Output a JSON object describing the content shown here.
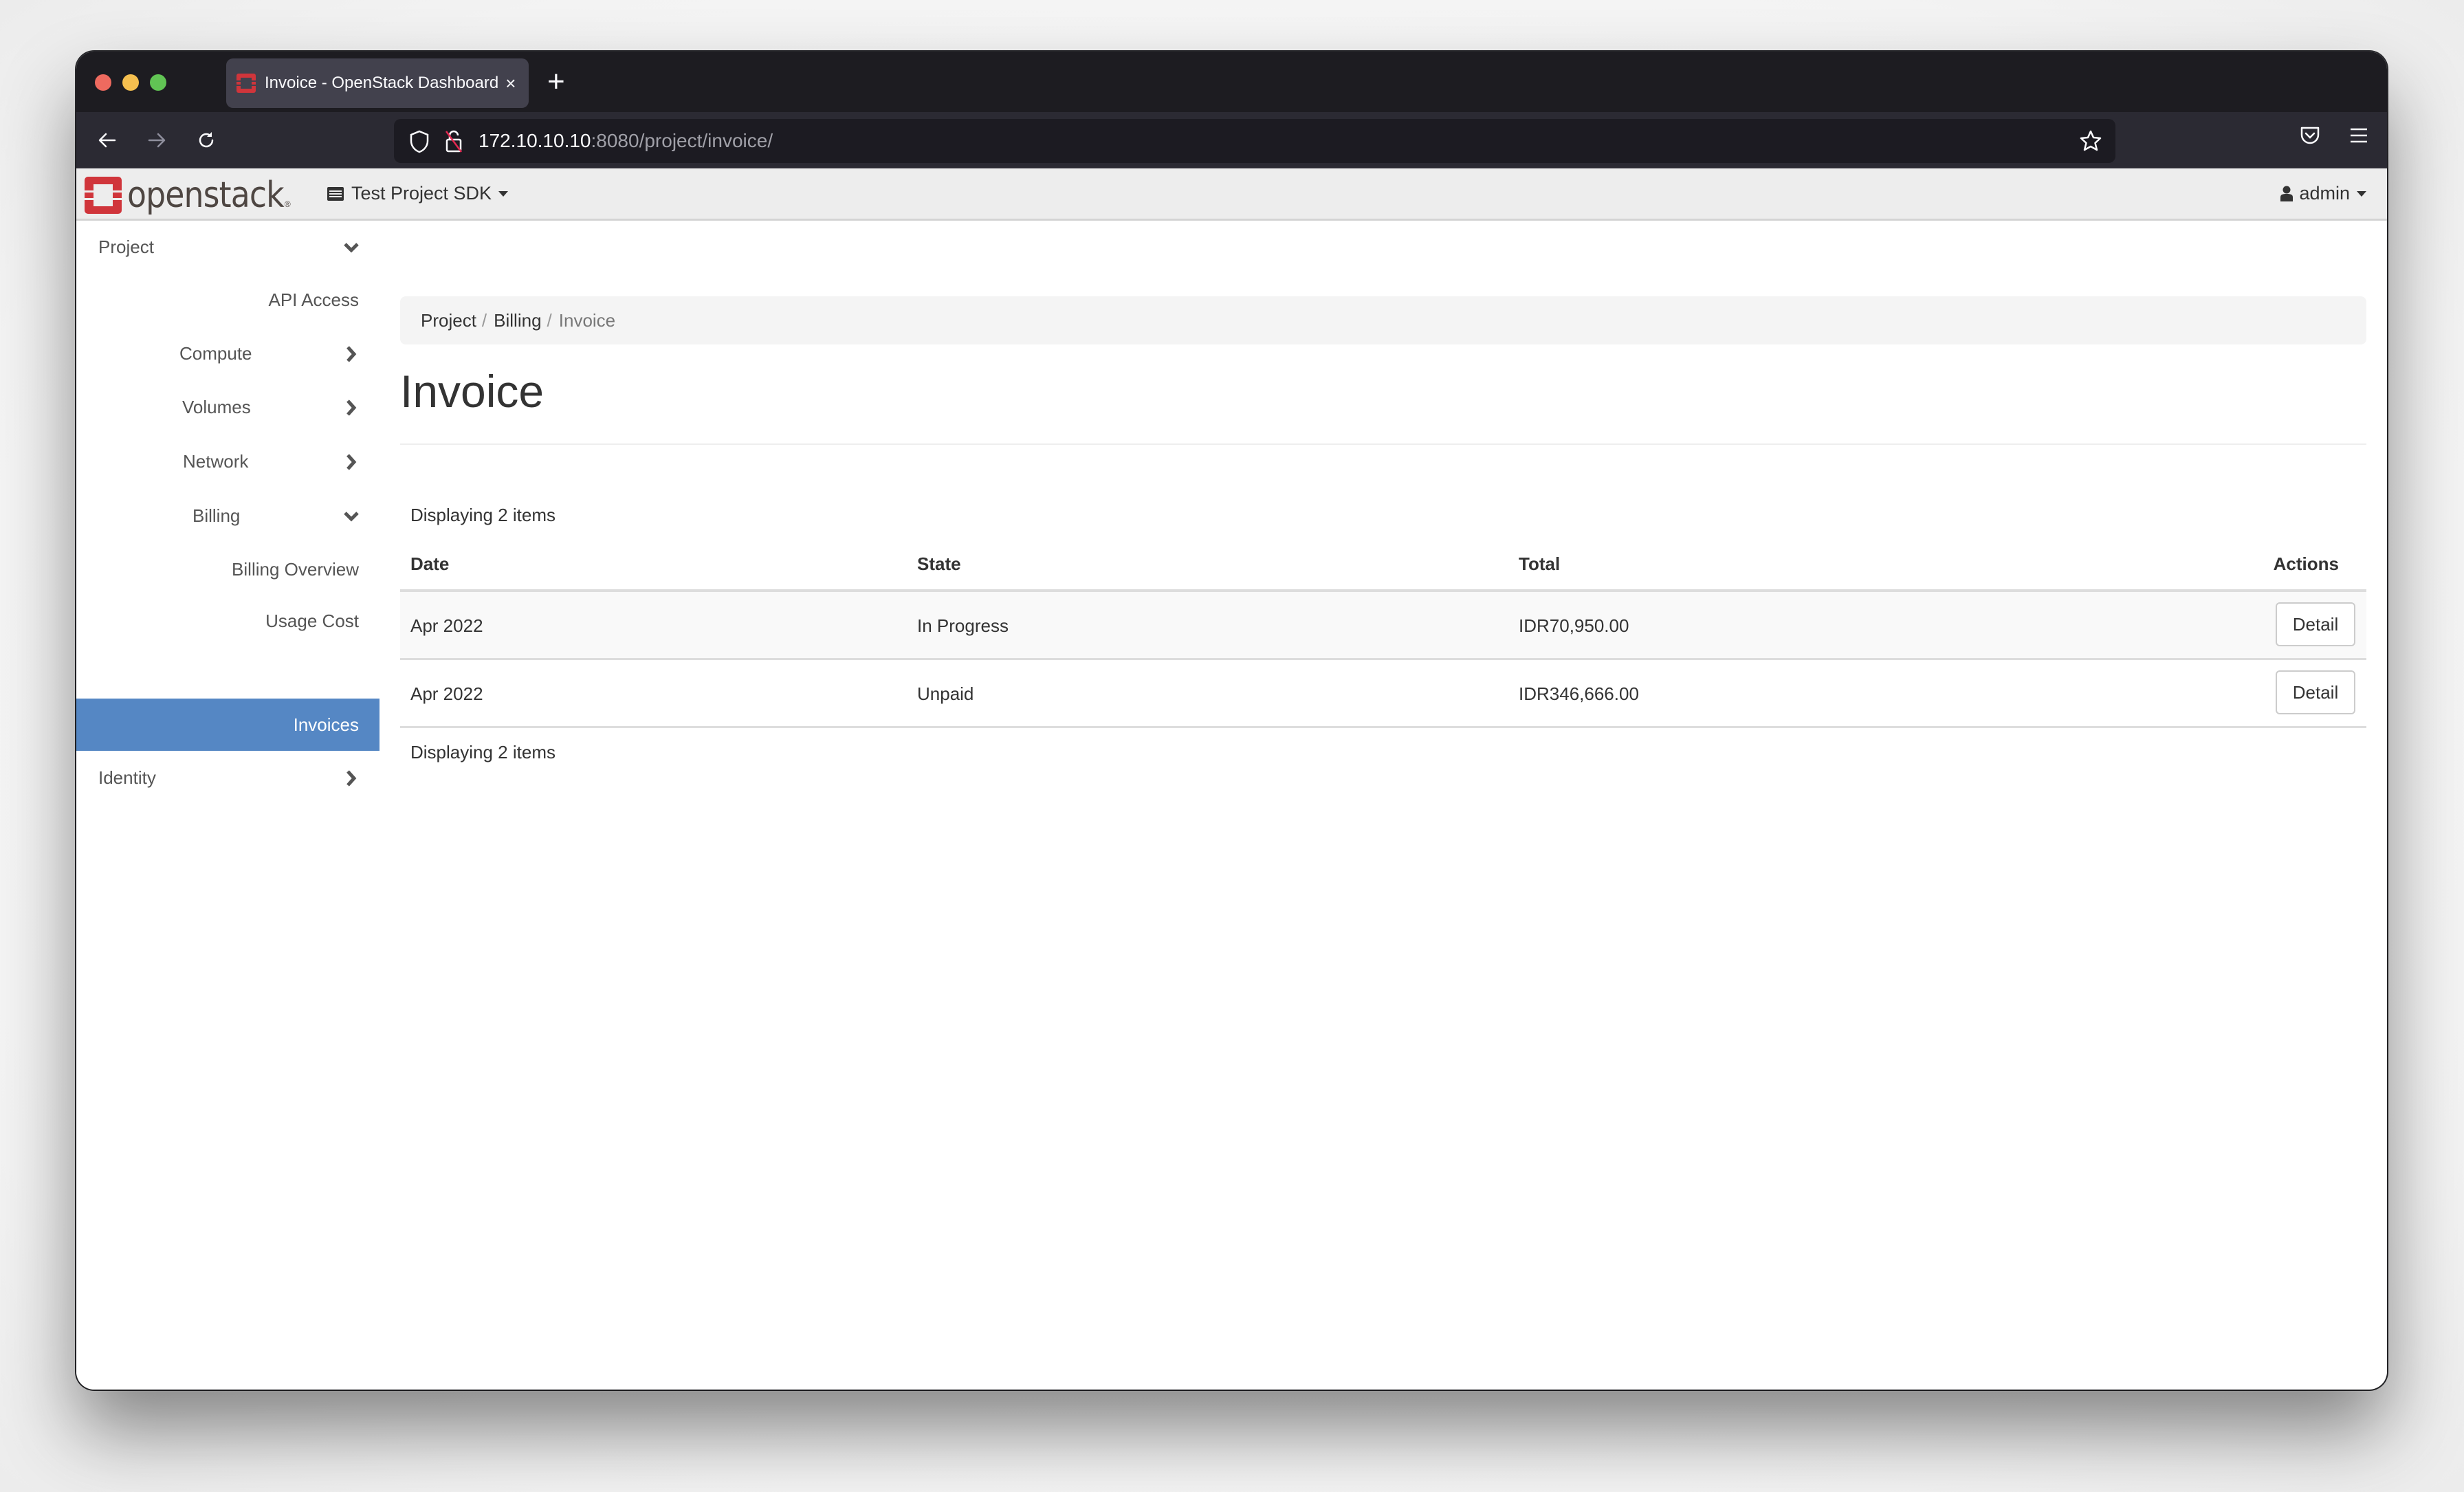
{
  "browser": {
    "tab_title": "Invoice - OpenStack Dashboard",
    "tab_close": "×",
    "new_tab": "+",
    "url_host": "172.10.10.10",
    "url_rest": ":8080/project/invoice/",
    "traffic_lights": {
      "close": "#ee6a5f",
      "minimize": "#f5bf4f",
      "zoom": "#61c454"
    }
  },
  "header": {
    "logo_text": "openstack",
    "logo_registered": "®",
    "project_selector": "Test Project SDK",
    "user_menu": "admin",
    "brand_color": "#d0353b"
  },
  "sidebar": {
    "items": [
      {
        "label": "Project",
        "icon": "chevron-down-icon",
        "level": 0
      },
      {
        "label": "API Access",
        "icon": null,
        "level": 2
      },
      {
        "label": "Compute",
        "icon": "chevron-right-icon",
        "level": 1
      },
      {
        "label": "Volumes",
        "icon": "chevron-right-icon",
        "level": 1
      },
      {
        "label": "Network",
        "icon": "chevron-right-icon",
        "level": 1
      },
      {
        "label": "Billing",
        "icon": "chevron-down-icon",
        "level": 1
      },
      {
        "label": "Billing Overview",
        "icon": null,
        "level": 2
      },
      {
        "label": "Usage Cost",
        "icon": null,
        "level": 2
      },
      {
        "label": "Invoices",
        "icon": null,
        "level": 2,
        "active": true
      },
      {
        "label": "Identity",
        "icon": "chevron-right-icon",
        "level": 0
      }
    ],
    "active_color": "#5587c4"
  },
  "breadcrumb": [
    "Project",
    "Billing",
    "Invoice"
  ],
  "breadcrumb_sep": "/",
  "page_title": "Invoice",
  "table": {
    "count_top": "Displaying 2 items",
    "count_bottom": "Displaying 2 items",
    "columns": [
      "Date",
      "State",
      "Total",
      "Actions"
    ],
    "rows": [
      {
        "date": "Apr 2022",
        "state": "In Progress",
        "total": "IDR70,950.00",
        "action": "Detail"
      },
      {
        "date": "Apr 2022",
        "state": "Unpaid",
        "total": "IDR346,666.00",
        "action": "Detail"
      }
    ]
  }
}
